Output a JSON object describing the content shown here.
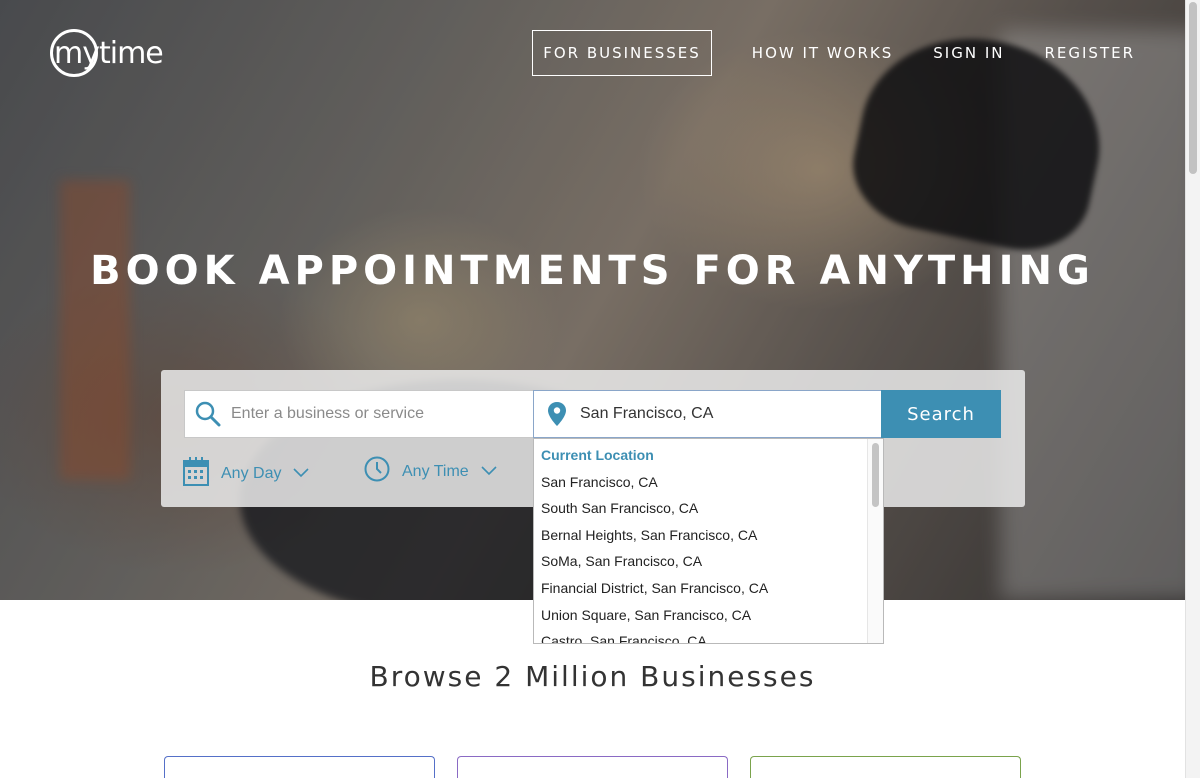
{
  "brand": {
    "logo_text": "mytime"
  },
  "nav": {
    "for_businesses": "FOR BUSINESSES",
    "how_it_works": "HOW IT WORKS",
    "sign_in": "SIGN IN",
    "register": "REGISTER"
  },
  "hero": {
    "headline": "BOOK APPOINTMENTS FOR ANYTHING"
  },
  "search": {
    "service_placeholder": "Enter a business or service",
    "location_value": "San Francisco, CA",
    "button_label": "Search",
    "day_filter": "Any Day",
    "time_filter": "Any Time"
  },
  "location_suggestions": {
    "current_location_label": "Current Location",
    "items": [
      "San Francisco, CA",
      "South San Francisco, CA",
      "Bernal Heights, San Francisco, CA",
      "SoMa, San Francisco, CA",
      "Financial District, San Francisco, CA",
      "Union Square, San Francisco, CA",
      "Castro, San Francisco, CA"
    ]
  },
  "browse": {
    "title": "Browse 2 Million Businesses"
  },
  "colors": {
    "accent": "#3d8fb3",
    "card_blue": "#5570c8",
    "card_purple": "#8a6ac4",
    "card_green": "#7aa34c"
  },
  "icons": [
    "search-icon",
    "location-pin-icon",
    "calendar-icon",
    "clock-icon",
    "chevron-down-icon"
  ]
}
